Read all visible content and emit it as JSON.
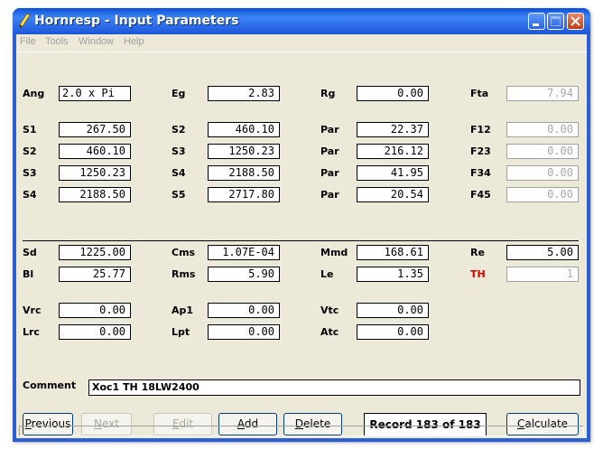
{
  "window": {
    "title": "Hornresp - Input Parameters"
  },
  "menu": [
    "File",
    "Tools",
    "Window",
    "Help"
  ],
  "params_top": [
    {
      "label": "Ang",
      "value": "2.0 x Pi",
      "align": "left"
    },
    {
      "label": "Eg",
      "value": "2.83"
    },
    {
      "label": "Rg",
      "value": "0.00"
    },
    {
      "label": "Fta",
      "value": "7.94",
      "grey": true
    }
  ],
  "rows_s": [
    [
      {
        "label": "S1",
        "value": "267.50"
      },
      {
        "label": "S2",
        "value": "460.10"
      },
      {
        "label": "Par",
        "value": "22.37"
      },
      {
        "label": "F12",
        "value": "0.00",
        "grey": true
      }
    ],
    [
      {
        "label": "S2",
        "value": "460.10"
      },
      {
        "label": "S3",
        "value": "1250.23"
      },
      {
        "label": "Par",
        "value": "216.12"
      },
      {
        "label": "F23",
        "value": "0.00",
        "grey": true
      }
    ],
    [
      {
        "label": "S3",
        "value": "1250.23"
      },
      {
        "label": "S4",
        "value": "2188.50"
      },
      {
        "label": "Par",
        "value": "41.95"
      },
      {
        "label": "F34",
        "value": "0.00",
        "grey": true
      }
    ],
    [
      {
        "label": "S4",
        "value": "2188.50"
      },
      {
        "label": "S5",
        "value": "2717.80"
      },
      {
        "label": "Par",
        "value": "20.54"
      },
      {
        "label": "F45",
        "value": "0.00",
        "grey": true
      }
    ]
  ],
  "driver": [
    [
      {
        "label": "Sd",
        "value": "1225.00"
      },
      {
        "label": "Cms",
        "value": "1.07E-04"
      },
      {
        "label": "Mmd",
        "value": "168.61"
      },
      {
        "label": "Re",
        "value": "5.00"
      }
    ],
    [
      {
        "label": "Bl",
        "value": "25.77"
      },
      {
        "label": "Rms",
        "value": "5.90"
      },
      {
        "label": "Le",
        "value": "1.35"
      },
      {
        "label": "TH",
        "value": "1",
        "red": true,
        "grey": true
      }
    ]
  ],
  "chambers": [
    [
      {
        "label": "Vrc",
        "value": "0.00"
      },
      {
        "label": "Ap1",
        "value": "0.00"
      },
      {
        "label": "Vtc",
        "value": "0.00"
      }
    ],
    [
      {
        "label": "Lrc",
        "value": "0.00"
      },
      {
        "label": "Lpt",
        "value": "0.00"
      },
      {
        "label": "Atc",
        "value": "0.00"
      }
    ]
  ],
  "comment": {
    "label": "Comment",
    "value": "Xoc1 TH 18LW2400"
  },
  "buttons": {
    "previous": {
      "mn": "P",
      "rest": "revious"
    },
    "next": {
      "mn": "N",
      "rest": "ext"
    },
    "edit": {
      "mn": "E",
      "rest": "dit"
    },
    "add": {
      "mn": "A",
      "rest": "dd"
    },
    "delete": {
      "mn": "D",
      "rest": "elete"
    },
    "calculate": {
      "mn": "C",
      "rest": "alculate"
    }
  },
  "record": "Record 183 of 183",
  "colors": {
    "title_bar": "#2c6be8",
    "face": "#ece9d8",
    "label_red": "#d40000"
  }
}
